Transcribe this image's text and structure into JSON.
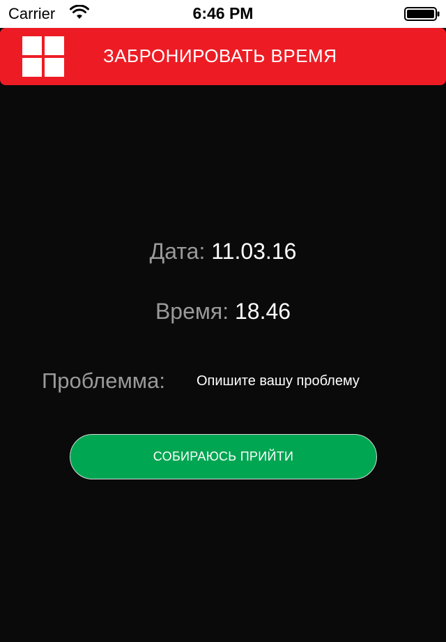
{
  "status_bar": {
    "carrier": "Carrier",
    "time": "6:46 PM",
    "wifi_icon": "wifi-icon",
    "battery_icon": "battery-icon"
  },
  "header": {
    "title": "ЗАБРОНИРОВАТЬ ВРЕМЯ",
    "menu_icon": "grid-menu-icon",
    "background_color": "#ed1c24"
  },
  "booking": {
    "date_label": "Дата:",
    "date_value": "11.03.16",
    "time_label": "Время:",
    "time_value": "18.46",
    "problem_label": "Проблемма:",
    "problem_placeholder": "Опишите вашу проблему",
    "problem_value": ""
  },
  "actions": {
    "submit_label": "СОБИРАЮСЬ ПРИЙТИ",
    "submit_color": "#00a651"
  },
  "colors": {
    "background": "#0a0a0a",
    "label_gray": "#9a9a9a",
    "text_white": "#ffffff"
  }
}
